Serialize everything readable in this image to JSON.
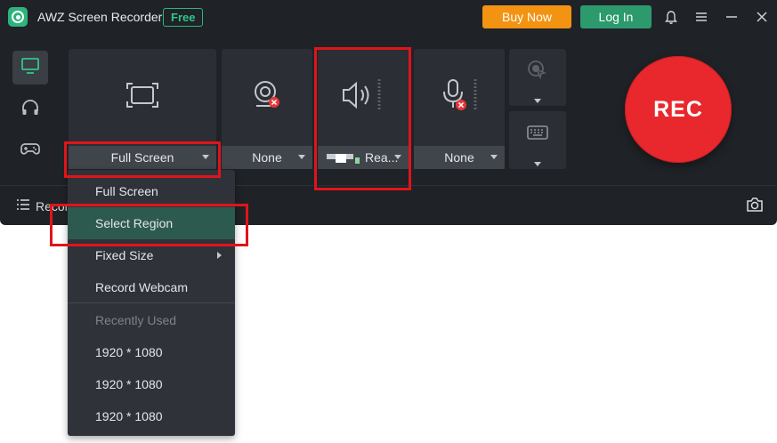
{
  "app": {
    "title": "AWZ Screen Recorder",
    "badge": "Free"
  },
  "header": {
    "buy_label": "Buy Now",
    "login_label": "Log In"
  },
  "icons": {
    "logo": "awz-logo-icon",
    "bell": "bell-icon",
    "menu": "menu-icon",
    "minimize": "minimize-icon",
    "close": "close-icon",
    "nav_screen": "monitor-icon",
    "nav_audio": "headphones-icon",
    "nav_game": "gamepad-icon",
    "region": "screen-region-icon",
    "webcam": "webcam-icon",
    "speaker": "speaker-icon",
    "microphone": "microphone-icon",
    "cursor": "cursor-click-icon",
    "keyboard": "keyboard-icon",
    "list": "list-icon",
    "camera": "camera-icon"
  },
  "panels": {
    "region": {
      "value": "Full Screen"
    },
    "webcam": {
      "value": "None"
    },
    "system_audio": {
      "value": "Rea..."
    },
    "microphone": {
      "value": "None"
    }
  },
  "rec_button": {
    "label": "REC"
  },
  "bottom": {
    "records_label": "Recor"
  },
  "dropdown": {
    "items": [
      {
        "label": "Full Screen"
      },
      {
        "label": "Select Region"
      },
      {
        "label": "Fixed Size"
      },
      {
        "label": "Record Webcam"
      }
    ],
    "recent_header": "Recently Used",
    "recent": [
      "1920 * 1080",
      "1920 * 1080",
      "1920 * 1080"
    ]
  },
  "colors": {
    "accent_green": "#2c9a6d",
    "buy_orange": "#f29312",
    "rec_red": "#e8282d",
    "annotation_red": "#e0141b",
    "highlight": "#2d5a4e"
  }
}
